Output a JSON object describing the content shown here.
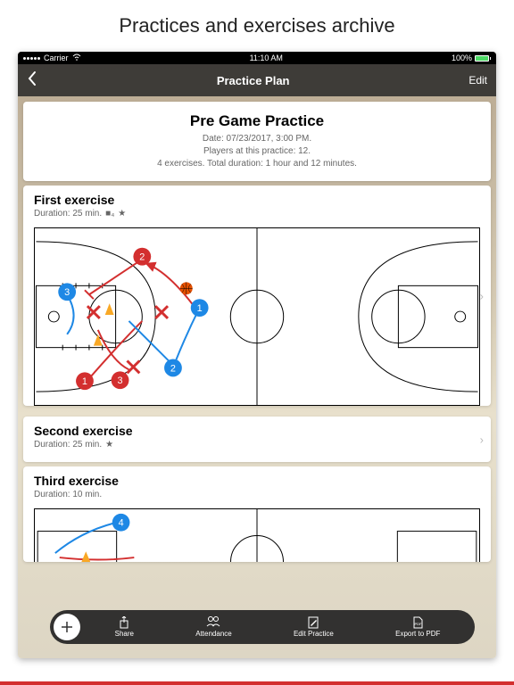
{
  "marketing": {
    "headline": "Practices and exercises archive"
  },
  "status": {
    "carrier": "Carrier",
    "time": "11:10 AM",
    "battery": "100%"
  },
  "nav": {
    "title": "Practice Plan",
    "edit": "Edit"
  },
  "headerCard": {
    "title": "Pre Game Practice",
    "line1": "Date: 07/23/2017, 3:00 PM.",
    "line2": "Players at this practice: 12.",
    "line3": "4 exercises. Total duration: 1 hour and 12 minutes."
  },
  "ex1": {
    "title": "First exercise",
    "duration": "Duration: 25 min."
  },
  "ex2": {
    "title": "Second exercise",
    "duration": "Duration: 25 min."
  },
  "ex3": {
    "title": "Third exercise",
    "duration": "Duration: 10 min."
  },
  "toolbar": {
    "share": "Share",
    "attendance": "Attendance",
    "editPractice": "Edit Practice",
    "exportPdf": "Export to PDF"
  }
}
